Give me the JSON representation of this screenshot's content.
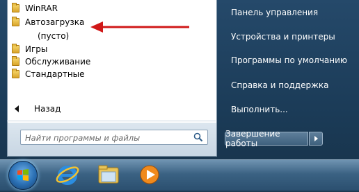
{
  "start_menu": {
    "programs": [
      {
        "label": "WinRAR",
        "icon": "folder-icon"
      },
      {
        "label": "Автозагрузка",
        "icon": "folder-icon"
      },
      {
        "label": "Игры",
        "icon": "folder-icon"
      },
      {
        "label": "Обслуживание",
        "icon": "folder-icon"
      },
      {
        "label": "Стандартные",
        "icon": "folder-icon"
      }
    ],
    "empty_label": "(пусто)",
    "back_label": "Назад",
    "search_placeholder": "Найти программы и файлы",
    "right_items": [
      "Панель управления",
      "Устройства и принтеры",
      "Программы по умолчанию",
      "Справка и поддержка",
      "Выполнить..."
    ],
    "shutdown_label": "Завершение работы"
  },
  "taskbar": {
    "icons": [
      "windows-start-icon",
      "internet-explorer-icon",
      "file-explorer-icon",
      "media-player-icon"
    ]
  },
  "colors": {
    "annotation_arrow": "#d01818",
    "menu_background": "#1f4260"
  }
}
